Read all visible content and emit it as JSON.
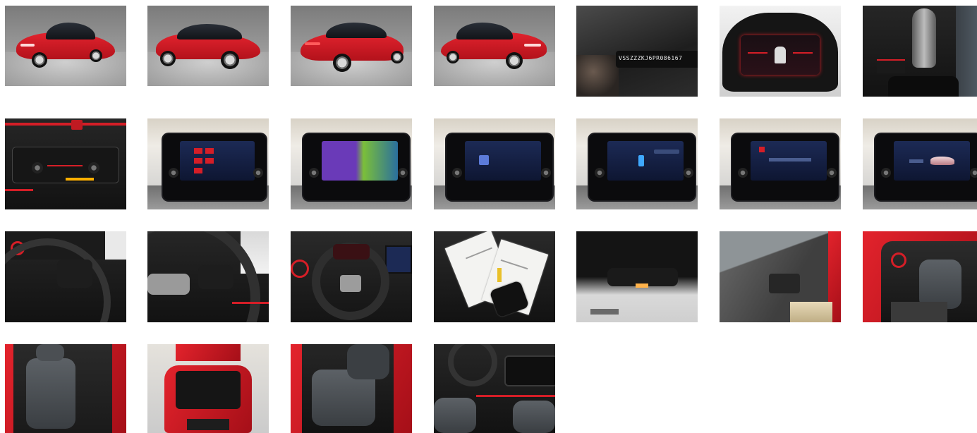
{
  "gallery": {
    "images": [
      {
        "id": 1,
        "icon": "car-front-left-photo"
      },
      {
        "id": 2,
        "icon": "car-side-rear-photo"
      },
      {
        "id": 3,
        "icon": "car-rear-photo"
      },
      {
        "id": 4,
        "icon": "car-front-right-photo"
      },
      {
        "id": 5,
        "icon": "vin-photo",
        "vin_text": "VSSZZZKJ6PR086167"
      },
      {
        "id": 6,
        "icon": "instrument-cluster-photo"
      },
      {
        "id": 7,
        "icon": "gear-selector-photo"
      },
      {
        "id": 8,
        "icon": "climate-control-photo"
      },
      {
        "id": 9,
        "icon": "infotainment-photo"
      },
      {
        "id": 10,
        "icon": "infotainment-photo"
      },
      {
        "id": 11,
        "icon": "infotainment-photo"
      },
      {
        "id": 12,
        "icon": "infotainment-photo"
      },
      {
        "id": 13,
        "icon": "infotainment-photo"
      },
      {
        "id": 14,
        "icon": "infotainment-photo"
      },
      {
        "id": 15,
        "icon": "steering-wheel-photo"
      },
      {
        "id": 16,
        "icon": "steering-wheel-photo"
      },
      {
        "id": 17,
        "icon": "steering-wheel-photo"
      },
      {
        "id": 18,
        "icon": "documents-keys-photo"
      },
      {
        "id": 19,
        "icon": "rear-mirror-photo"
      },
      {
        "id": 20,
        "icon": "door-panel-photo"
      },
      {
        "id": 21,
        "icon": "interior-photo"
      },
      {
        "id": 22,
        "icon": "rear-seats-photo"
      },
      {
        "id": 23,
        "icon": "trunk-photo"
      },
      {
        "id": 24,
        "icon": "rear-seats-photo"
      },
      {
        "id": 25,
        "icon": "interior-photo"
      }
    ],
    "colors": {
      "car_red": "#d51e27",
      "background": "#ffffff"
    }
  }
}
